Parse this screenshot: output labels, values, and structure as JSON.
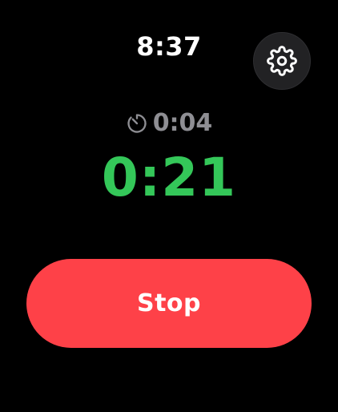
{
  "status_bar": {
    "time": "8:37"
  },
  "settings": {
    "icon": "gear-icon"
  },
  "interval": {
    "icon": "timer-icon",
    "value": "0:04",
    "color": "#8e8e93"
  },
  "elapsed": {
    "value": "0:21",
    "color": "#34c759"
  },
  "stop_button": {
    "label": "Stop",
    "color": "#fe4148"
  }
}
